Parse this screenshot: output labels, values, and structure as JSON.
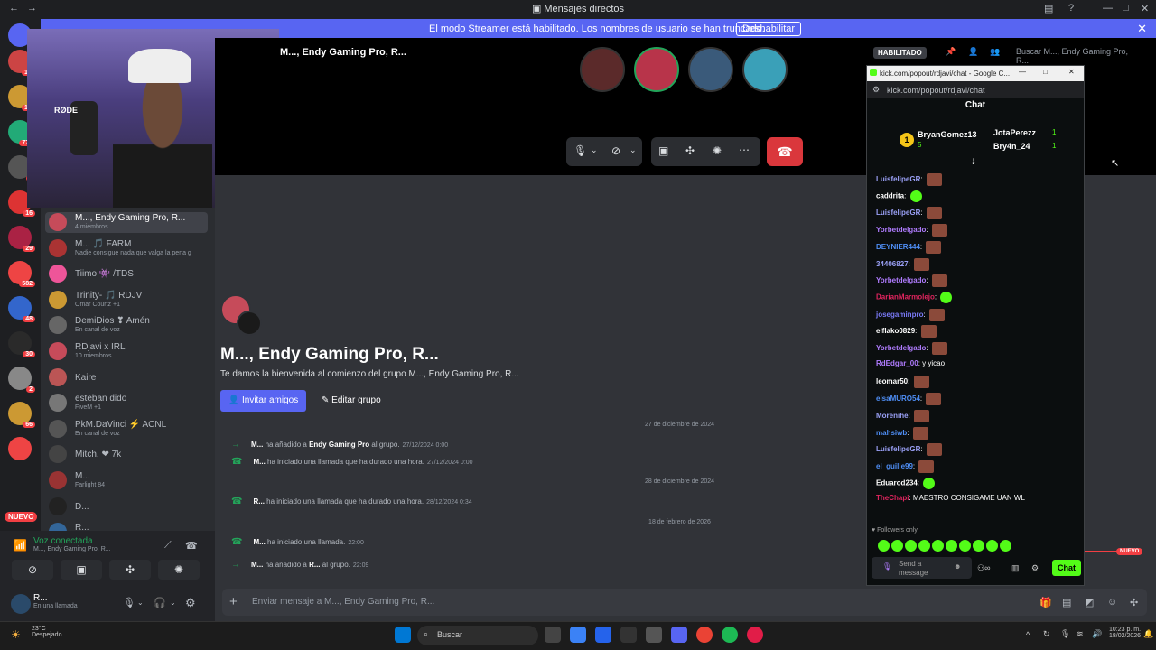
{
  "window": {
    "title": "Mensajes directos"
  },
  "streamer": {
    "message": "El modo Streamer está habilitado. Los nombres de usuario se han truncado.",
    "button": "Deshabilitar"
  },
  "servers": [
    {
      "badge": "1K"
    },
    {
      "badge": "1K"
    },
    {
      "badge": "773"
    },
    {
      "badge": "2"
    },
    {
      "badge": "16"
    },
    {
      "badge": "29"
    },
    {
      "badge": "582"
    },
    {
      "badge": "48"
    },
    {
      "badge": "30"
    },
    {
      "badge": "2"
    },
    {
      "badge": "66"
    },
    {
      "badge": ""
    },
    {
      "badge": "NUEVO"
    }
  ],
  "dms": [
    {
      "name": "M..., Endy Gaming Pro, R...",
      "sub": "4 miembros",
      "color": "#c64b5a",
      "active": true
    },
    {
      "name": "M... 🎵 FARM",
      "sub": "Nadie consigue nada que valga la pena g",
      "color": "#a33"
    },
    {
      "name": "Tiimo 👾 /TDS",
      "sub": "",
      "color": "#e59"
    },
    {
      "name": "Trinity- 🎵 RDJV",
      "sub": "Omar Courtz +1",
      "color": "#c93"
    },
    {
      "name": "DemiDios ❣ Amén",
      "sub": "En canal de voz",
      "color": "#666"
    },
    {
      "name": "RDjavi x IRL",
      "sub": "10 miembros",
      "color": "#c64b5a"
    },
    {
      "name": "Kaire",
      "sub": "",
      "color": "#b55"
    },
    {
      "name": "esteban dido",
      "sub": "FiveM +1",
      "color": "#777"
    },
    {
      "name": "PkM.DaVinci ⚡ ACNL",
      "sub": "En canal de voz",
      "color": "#555"
    },
    {
      "name": "Mitch. ❤ 7k",
      "sub": "",
      "color": "#444"
    },
    {
      "name": "M...",
      "sub": "Farlight 84",
      "color": "#933"
    },
    {
      "name": "D...",
      "sub": "",
      "color": "#222"
    },
    {
      "name": "R...",
      "sub": "En una llamada",
      "color": "#369"
    }
  ],
  "voice": {
    "title": "Voz conectada",
    "channel": "M..., Endy Gaming Pro, R..."
  },
  "user": {
    "name": "R...",
    "status": "En una llamada"
  },
  "call": {
    "title": "M..., Endy Gaming Pro, R..."
  },
  "header": {
    "habilitado": "HABILITADO",
    "search_placeholder": "Buscar M..., Endy Gaming Pro, R..."
  },
  "group": {
    "title": "M..., Endy Gaming Pro, R...",
    "welcome": "Te damos la bienvenida al comienzo del grupo M..., Endy Gaming Pro, R...",
    "invite": "Invitar amigos",
    "edit": "Editar grupo"
  },
  "messages": [
    {
      "date": "27 de diciembre de 2024"
    },
    {
      "icon": "→",
      "actor": "M...",
      "text": " ha añadido a ",
      "bold": "Endy Gaming Pro",
      "rest": " al grupo.",
      "ts": "27/12/2024 0:00"
    },
    {
      "icon": "☎",
      "actor": "M...",
      "text": " ha iniciado una llamada que ha durado una hora.",
      "bold": "",
      "rest": "",
      "ts": "27/12/2024 0:00"
    },
    {
      "date": "28 de diciembre de 2024"
    },
    {
      "icon": "☎",
      "actor": "R...",
      "text": " ha iniciado una llamada que ha durado una hora.",
      "bold": "",
      "rest": "",
      "ts": "28/12/2024 0:34"
    },
    {
      "date": "18 de febrero de 2026"
    },
    {
      "icon": "☎",
      "actor": "M...",
      "text": " ha iniciado una llamada.",
      "bold": "",
      "rest": "",
      "ts": "22:00"
    },
    {
      "icon": "→",
      "actor": "M...",
      "text": " ha añadido a ",
      "bold": "R...",
      "rest": " al grupo.",
      "ts": "22:09"
    }
  ],
  "composer": {
    "placeholder": "Enviar mensaje a M..., Endy Gaming Pro, R...",
    "nuevo": "NUEVO"
  },
  "kick": {
    "window_title": "kick.com/popout/rdjavi/chat - Google C...",
    "url": "kick.com/popout/rdjavi/chat",
    "title": "Chat",
    "gifters": [
      {
        "rank": "1",
        "name": "BryanGomez13",
        "count": "5"
      },
      {
        "rank": "",
        "name": "JotaPerezz",
        "count": "1"
      },
      {
        "rank": "",
        "name": "Bry4n_24",
        "count": "1"
      }
    ],
    "lines": [
      {
        "user": "LuisfelipeGR",
        "color": "#9aa0f6",
        "text": "",
        "emote": "brown"
      },
      {
        "user": "caddrita",
        "color": "#ffffff",
        "text": "",
        "emote": "green"
      },
      {
        "user": "LuisfelipeGR",
        "color": "#9aa0f6",
        "text": "",
        "emote": "brown"
      },
      {
        "user": "Yorbetdelgado",
        "color": "#b07cff",
        "text": "",
        "emote": "brown"
      },
      {
        "user": "DEYNIER444",
        "color": "#4f8ff7",
        "text": "",
        "emote": "brown"
      },
      {
        "user": "34406827",
        "color": "#9aa0f6",
        "text": "",
        "emote": "brown"
      },
      {
        "user": "Yorbetdelgado",
        "color": "#b07cff",
        "text": "",
        "emote": "brown"
      },
      {
        "user": "DarianMarmolejo",
        "color": "#e0245e",
        "text": "",
        "emote": "green"
      },
      {
        "user": "josegaminpro",
        "color": "#7a7af7",
        "text": "",
        "emote": "brown"
      },
      {
        "user": "elflako0829",
        "color": "#ffffff",
        "text": "",
        "emote": "brown"
      },
      {
        "user": "Yorbetdelgado",
        "color": "#b07cff",
        "text": "",
        "emote": "brown"
      },
      {
        "user": "RdEdgar_00",
        "color": "#b07cff",
        "text": "y yicao",
        "emote": ""
      },
      {
        "user": "leomar50",
        "color": "#ffffff",
        "text": "",
        "emote": "brown"
      },
      {
        "user": "elsaMURO54",
        "color": "#4f8ff7",
        "text": "",
        "emote": "brown"
      },
      {
        "user": "Morenihe",
        "color": "#9aa0f6",
        "text": "",
        "emote": "brown"
      },
      {
        "user": "mahsiwb",
        "color": "#4f8ff7",
        "text": "",
        "emote": "brown"
      },
      {
        "user": "LuisfelipeGR",
        "color": "#9aa0f6",
        "text": "",
        "emote": "brown"
      },
      {
        "user": "el_guille99",
        "color": "#4f8ff7",
        "text": "",
        "emote": "brown"
      },
      {
        "user": "Eduarod234",
        "color": "#ffffff",
        "text": "",
        "emote": "green"
      },
      {
        "user": "TheChapi",
        "color": "#e0245e",
        "text": "MAESTRO CONSIGAME UAN WL",
        "emote": ""
      }
    ],
    "followers": "Followers only",
    "send_placeholder": "Send a message",
    "chat_button": "Chat"
  },
  "taskbar": {
    "weather_temp": "23°C",
    "weather_desc": "Despejado",
    "search": "Buscar",
    "time": "10:23 p. m.",
    "date": "18/02/2026"
  }
}
